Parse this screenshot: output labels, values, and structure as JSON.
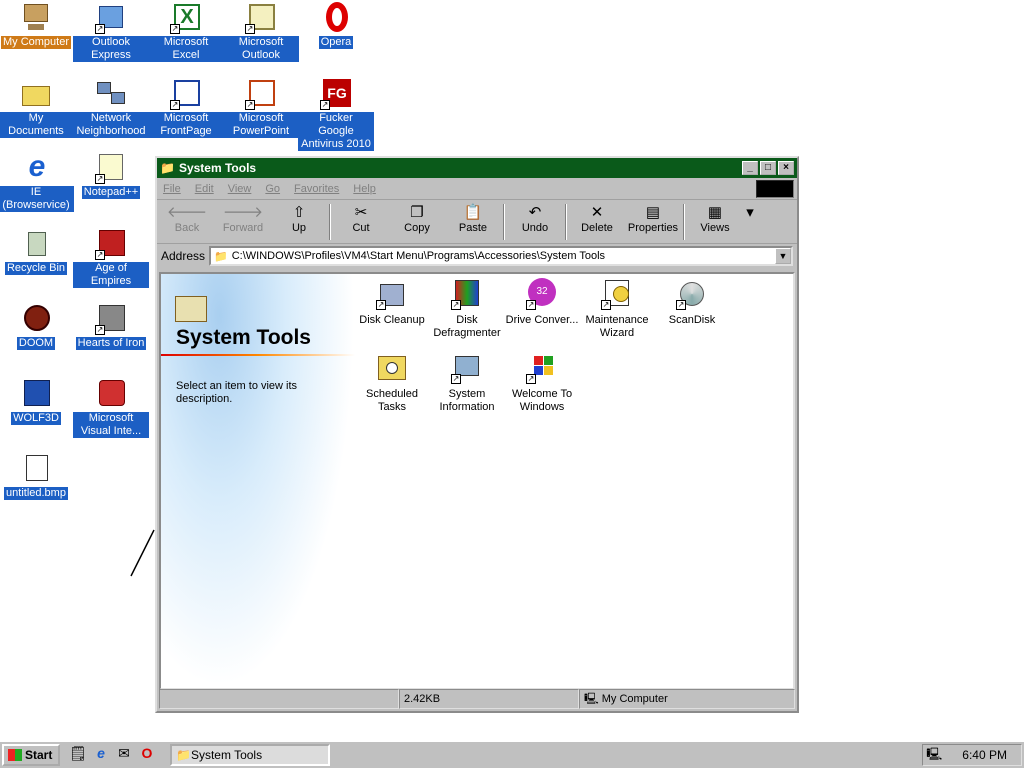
{
  "desktop": {
    "icons": [
      {
        "label": "My Computer"
      },
      {
        "label": "Outlook Express"
      },
      {
        "label": "Microsoft Excel"
      },
      {
        "label": "Microsoft Outlook"
      },
      {
        "label": "Opera"
      },
      {
        "label": "My Documents"
      },
      {
        "label": "Network Neighborhood"
      },
      {
        "label": "Microsoft FrontPage"
      },
      {
        "label": "Microsoft PowerPoint"
      },
      {
        "label": "Fucker Google Antivirus 2010"
      },
      {
        "label": "IE (Browservice)"
      },
      {
        "label": "Notepad++"
      },
      {
        "label": "Recycle Bin"
      },
      {
        "label": "Age of Empires"
      },
      {
        "label": "DOOM"
      },
      {
        "label": "Hearts of Iron"
      },
      {
        "label": "WOLF3D"
      },
      {
        "label": "Microsoft Visual Inte..."
      },
      {
        "label": "untitled.bmp"
      }
    ]
  },
  "window": {
    "title": "System Tools",
    "menu": [
      "File",
      "Edit",
      "View",
      "Go",
      "Favorites",
      "Help"
    ],
    "toolbar": [
      "Back",
      "Forward",
      "Up",
      "Cut",
      "Copy",
      "Paste",
      "Undo",
      "Delete",
      "Properties",
      "Views"
    ],
    "address_label": "Address",
    "address": "C:\\WINDOWS\\Profiles\\VM4\\Start Menu\\Programs\\Accessories\\System Tools",
    "panel_title": "System Tools",
    "panel_desc": "Select an item to view its description.",
    "items": [
      {
        "label": "Disk Cleanup"
      },
      {
        "label": "Disk Defragmenter"
      },
      {
        "label": "Drive Conver..."
      },
      {
        "label": "Maintenance Wizard"
      },
      {
        "label": "ScanDisk"
      },
      {
        "label": "Scheduled Tasks"
      },
      {
        "label": "System Information"
      },
      {
        "label": "Welcome To Windows"
      }
    ],
    "status": {
      "size": "2.42KB",
      "zone": "My Computer"
    }
  },
  "taskbar": {
    "start": "Start",
    "task": "System Tools",
    "clock": "6:40 PM"
  }
}
